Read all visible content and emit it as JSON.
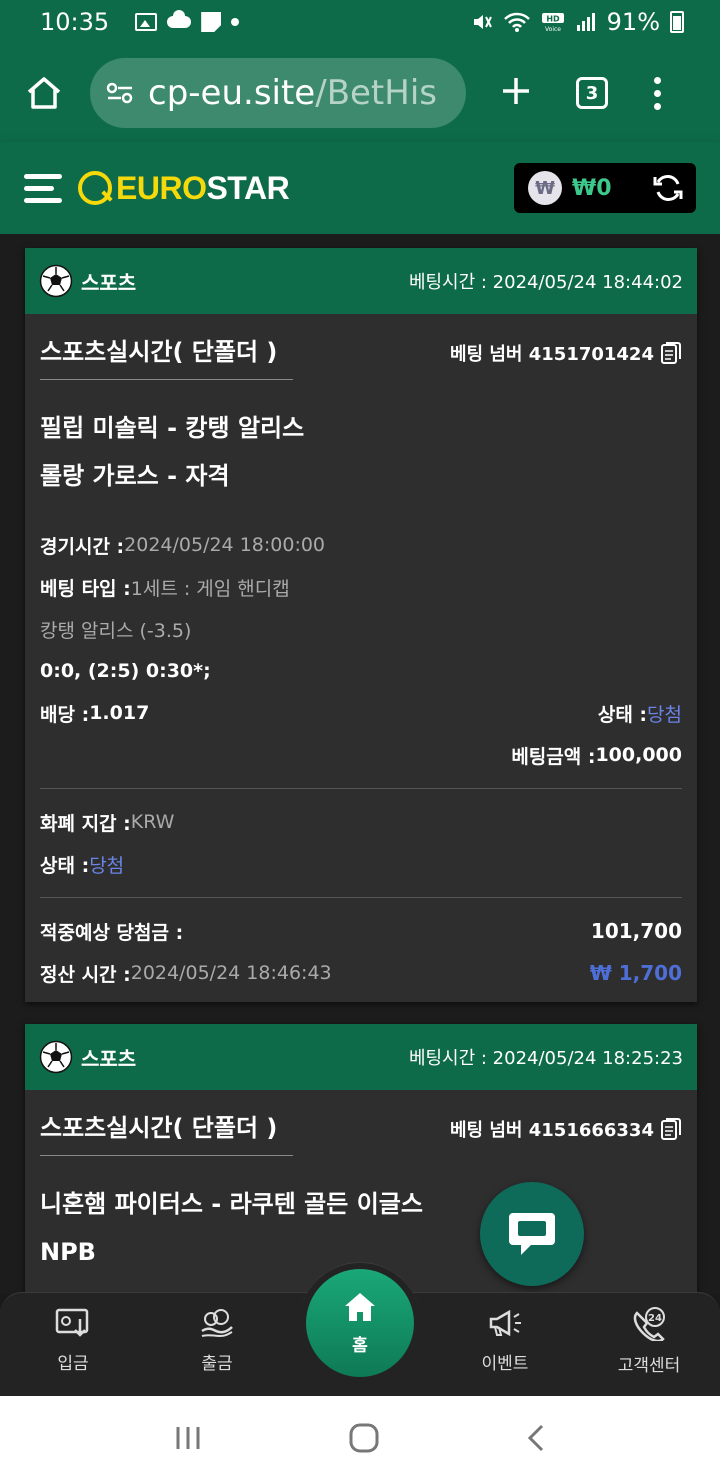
{
  "status_bar": {
    "time": "10:35",
    "battery": "91%"
  },
  "browser": {
    "url_host": "cp-eu.site",
    "url_path": "/BetHis",
    "tab_count": "3"
  },
  "header": {
    "logo_euro": "EURO",
    "logo_star": "STAR",
    "currency_symbol": "₩",
    "balance": "₩0"
  },
  "bets": [
    {
      "category": "스포츠",
      "bet_time": "베팅시간 : 2024/05/24 18:44:02",
      "title": "스포츠실시간( 단폴더 )",
      "bet_number": "베팅 넘버 4151701424",
      "match_line1": "필립 미솔릭 - 캉탱 알리스",
      "match_line2": "롤랑 가로스 - 자격",
      "game_time_label": "경기시간 : ",
      "game_time": "2024/05/24 18:00:00",
      "bet_type_label": "베팅 타입 : ",
      "bet_type": "1세트 : 게임 핸디캡",
      "selection": "캉탱 알리스 (-3.5)",
      "score": "0:0, (2:5) 0:30*;",
      "odds_label": "배당 : ",
      "odds": "1.017",
      "status_label": "상태 : ",
      "status": "당첨",
      "stake_label": "베팅금액 : ",
      "stake": "100,000",
      "wallet_label": "화폐 지갑 : ",
      "wallet": "KRW",
      "status2_label": "상태 : ",
      "status2": "당첨",
      "expected_label": "적중예상 당첨금 : ",
      "expected": "101,700",
      "settle_label": "정산 시간 : ",
      "settle_time": "2024/05/24 18:46:43",
      "profit": "₩ 1,700"
    },
    {
      "category": "스포츠",
      "bet_time": "베팅시간 : 2024/05/24 18:25:23",
      "title": "스포츠실시간( 단폴더 )",
      "bet_number": "베팅 넘버 4151666334",
      "match_line1": "니혼햄 파이터스 - 라쿠텐 골든 이글스",
      "match_line2": "NPB"
    }
  ],
  "bottom_nav": {
    "deposit": "입금",
    "withdraw": "출금",
    "home": "홈",
    "event": "이벤트",
    "support": "고객센터"
  },
  "colors": {
    "brand_green": "#0e6b4a",
    "logo_yellow": "#f5d90a",
    "win_blue": "#6b84e8"
  },
  "icons": [
    "image-icon",
    "cloud-icon",
    "note-icon",
    "mute-icon",
    "wifi-icon",
    "signal-icon",
    "battery-icon",
    "home-icon",
    "tune-icon",
    "plus-icon",
    "tabs-icon",
    "more-icon",
    "menu-icon",
    "won-icon",
    "refresh-icon",
    "soccer-ball-icon",
    "copy-icon",
    "chat-icon",
    "deposit-icon",
    "withdraw-icon",
    "house-icon",
    "megaphone-icon",
    "support-24-icon",
    "recent-apps-icon",
    "home-circle-icon",
    "back-icon"
  ]
}
